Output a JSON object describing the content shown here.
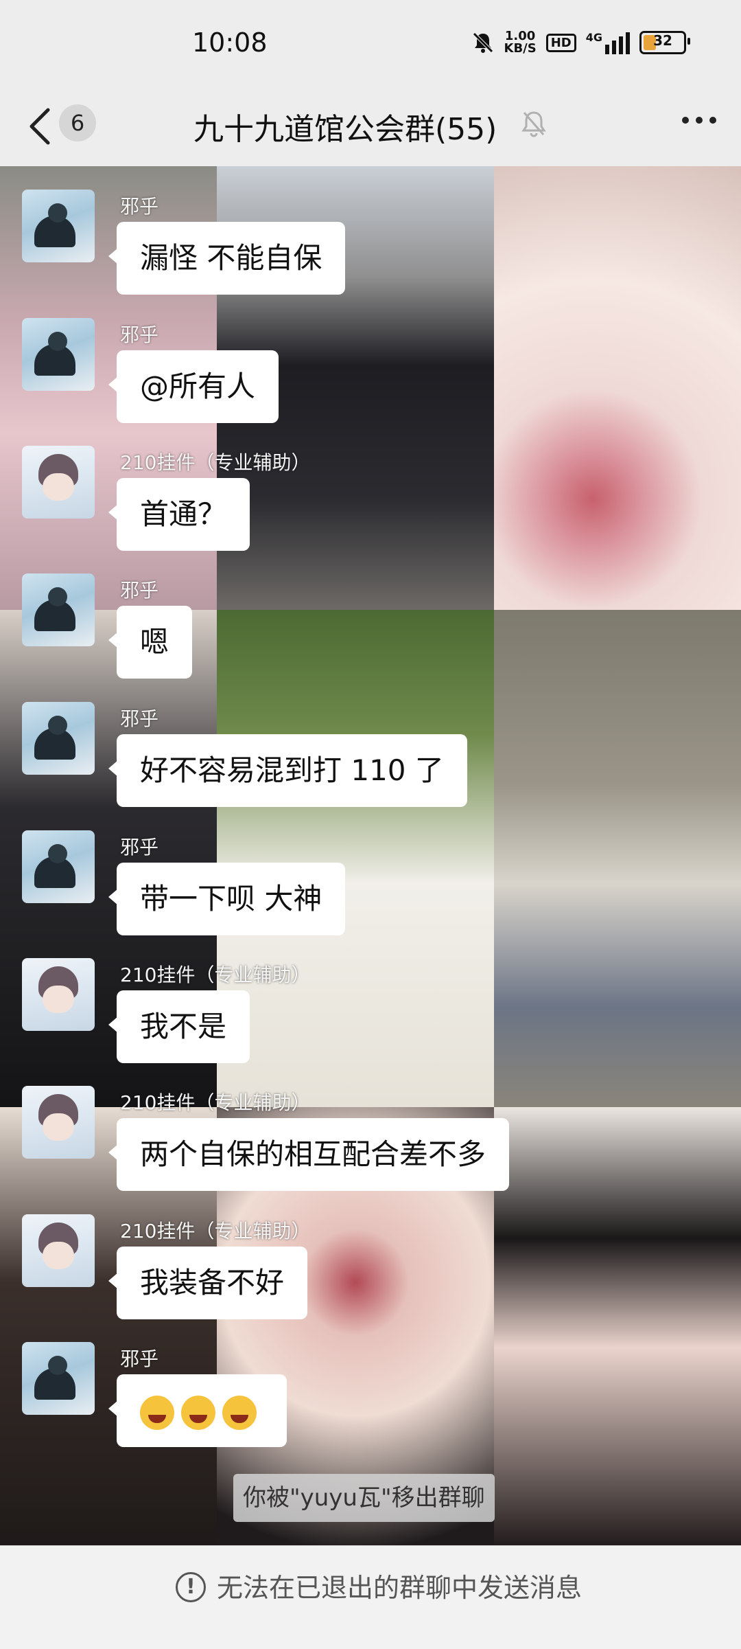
{
  "status_bar": {
    "time": "10:08",
    "network_speed_value": "1.00",
    "network_speed_unit": "KB/S",
    "hd_label": "HD",
    "network_type": "4G",
    "battery_level": "32",
    "battery_color": "#e9a33b"
  },
  "header": {
    "back_icon": "chevron-left-icon",
    "unread_count": "6",
    "title": "九十九道馆公会群(55)",
    "mute_icon": "bell-off-icon",
    "more_icon": "ellipsis-icon"
  },
  "messages": [
    {
      "sender": "邪乎",
      "avatar": "xiehu",
      "text": "漏怪 不能自保"
    },
    {
      "sender": "邪乎",
      "avatar": "xiehu",
      "text": "@所有人"
    },
    {
      "sender": "210挂件（专业辅助）",
      "avatar": "guajian",
      "text": "首通？"
    },
    {
      "sender": "邪乎",
      "avatar": "xiehu",
      "text": "嗯"
    },
    {
      "sender": "邪乎",
      "avatar": "xiehu",
      "text": "好不容易混到打 110 了"
    },
    {
      "sender": "邪乎",
      "avatar": "xiehu",
      "text": "带一下呗 大神"
    },
    {
      "sender": "210挂件（专业辅助）",
      "avatar": "guajian",
      "text": "我不是"
    },
    {
      "sender": "210挂件（专业辅助）",
      "avatar": "guajian",
      "text": "两个自保的相互配合差不多"
    },
    {
      "sender": "210挂件（专业辅助）",
      "avatar": "guajian",
      "text": "我装备不好"
    },
    {
      "sender": "邪乎",
      "avatar": "xiehu",
      "text": "",
      "emoji": [
        "loudly-crying-face",
        "loudly-crying-face",
        "loudly-crying-face"
      ]
    }
  ],
  "system_notice": "你被\"yuyu瓦\"移出群聊",
  "footer": {
    "icon": "exclamation-circle-icon",
    "text": "无法在已退出的群聊中发送消息"
  }
}
